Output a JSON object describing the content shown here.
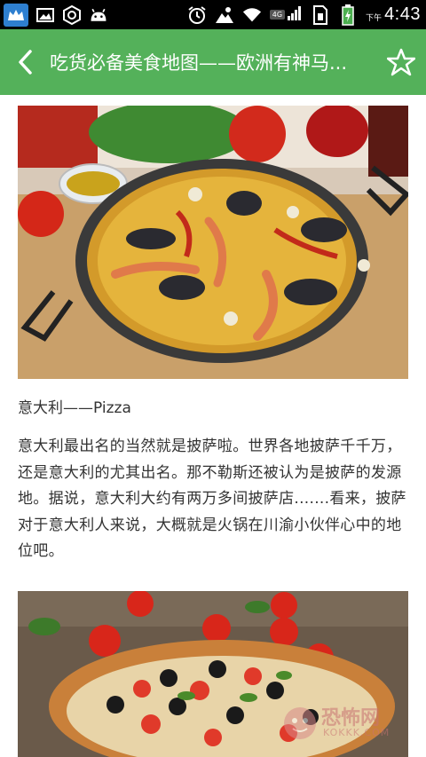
{
  "status_bar": {
    "time": "4:43",
    "ampm": "下午",
    "network": "4G",
    "icons": [
      "app-crown-icon",
      "gallery-icon",
      "hexagon-icon",
      "android-icon",
      "alarm-icon",
      "weather-icon",
      "wifi-icon",
      "signal-icon",
      "sim-icon",
      "battery-icon"
    ]
  },
  "title_bar": {
    "title": "吃货必备美食地图——欧洲有神马...",
    "background": "#54b15a"
  },
  "article": {
    "caption_1": "意大利——Pizza",
    "paragraph_1": "意大利最出名的当然就是披萨啦。世界各地披萨千千万，还是意大利的尤其出名。那不勒斯还被认为是披萨的发源地。据说，意大利大约有两万多间披萨店.......看来，披萨对于意大利人来说，大概就是火锅在川渝小伙伴心中的地位吧。"
  },
  "watermark": {
    "text": "恐怖网",
    "url": "KOKKK.COM"
  }
}
